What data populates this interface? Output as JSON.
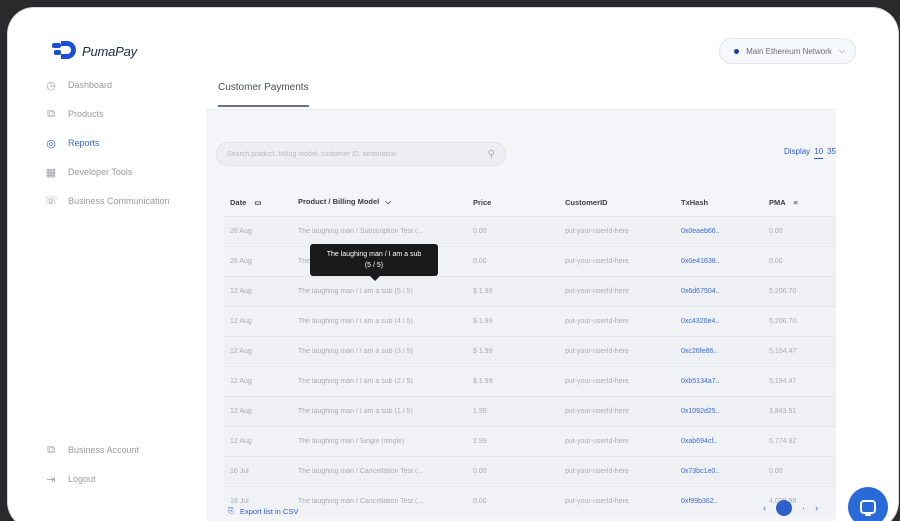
{
  "brand": {
    "name": "PumaPay"
  },
  "network": {
    "label": "Main Ethereum Network"
  },
  "sidebar": {
    "items": [
      {
        "label": "Dashboard",
        "icon": "dashboard-icon",
        "glyph": "◷",
        "active": false
      },
      {
        "label": "Products",
        "icon": "products-icon",
        "glyph": "⧉",
        "active": false
      },
      {
        "label": "Reports",
        "icon": "reports-icon",
        "glyph": "◎",
        "active": true
      },
      {
        "label": "Developer Tools",
        "icon": "developer-tools-icon",
        "glyph": "▦",
        "active": false
      },
      {
        "label": "Business Communication",
        "icon": "business-communication-icon",
        "glyph": "☏",
        "active": false
      }
    ],
    "bottom": [
      {
        "label": "Business Account",
        "icon": "business-account-icon",
        "glyph": "⧉"
      },
      {
        "label": "Logout",
        "icon": "logout-icon",
        "glyph": "⇥"
      }
    ]
  },
  "main": {
    "tab": "Customer Payments",
    "search": {
      "placeholder": "Search product, billing model, customer ID, destination"
    },
    "display": {
      "label": "Display",
      "options": [
        "10",
        "35"
      ],
      "selected": "10"
    },
    "table": {
      "headers": [
        "Date",
        "Product / Billing Model",
        "Price",
        "CustomerID",
        "TxHash",
        "PMA"
      ],
      "rows": [
        [
          "28 Aug",
          "The laughing man / Subscription Test (...",
          "0.00",
          "put-your-userId-here",
          "0x0eaeb66..",
          "0.00"
        ],
        [
          "28 Aug",
          "The laughing man / Subscription Test (...",
          "0.00",
          "put-your-userId-here",
          "0x0e41638..",
          "0.00"
        ],
        [
          "12 Aug",
          "The laughing man / I am a sub (5 / 5)",
          "$ 1.99",
          "put-your-userId-here",
          "0x6d67504..",
          "5,206.70"
        ],
        [
          "12 Aug",
          "The laughing man / I am a sub (4 / 5)",
          "$ 1.99",
          "put-your-userId-here",
          "0xc4320e4..",
          "5,206.70"
        ],
        [
          "12 Aug",
          "The laughing man / I am a sub (3 / 5)",
          "$ 1.99",
          "put-your-userId-here",
          "0xc26fe86..",
          "5,194.47"
        ],
        [
          "12 Aug",
          "The laughing man / I am a sub (2 / 5)",
          "$ 1.99",
          "put-your-userId-here",
          "0xb5134a7..",
          "5,194.47"
        ],
        [
          "12 Aug",
          "The laughing man / I am a sub (1 / 5)",
          "1.99",
          "put-your-userId-here",
          "0x1092d25..",
          "3,843.51"
        ],
        [
          "12 Aug",
          "The laughing man / Single (single)",
          "2.99",
          "put-your-userId-here",
          "0xab694cf..",
          "5,774.92"
        ],
        [
          "16 Jul",
          "The laughing man / Cancellation Test (...",
          "0.00",
          "put-your-userId-here",
          "0x73bc1e0..",
          "0.00"
        ],
        [
          "16 Jul",
          "The laughing man / Cancellation Test (...",
          "0.00",
          "put-your-userId-here",
          "0xf99b362..",
          "4,028.98"
        ]
      ]
    },
    "tooltip": {
      "line1": "The laughing man / I am a sub",
      "line2": "(5 / 5)"
    },
    "export": {
      "label": "Export list in CSV"
    }
  },
  "colors": {
    "accent": "#2f5fc8",
    "brand": "#1a4fd6",
    "chat": "#2a6ad8"
  }
}
